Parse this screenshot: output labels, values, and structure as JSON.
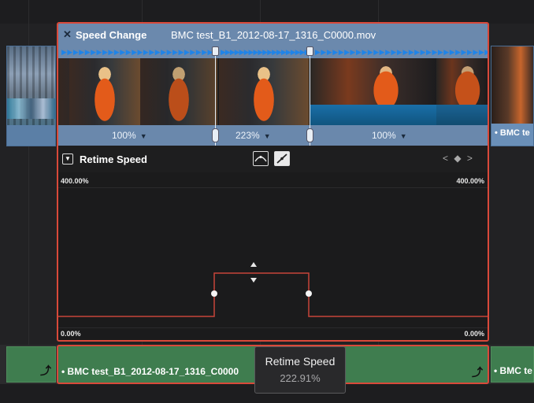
{
  "speed_change": {
    "label": "Speed Change",
    "close_icon": "close-icon",
    "clip_filename": "BMC test_B1_2012-08-17_1316_C0000.mov"
  },
  "segments": [
    {
      "speed": "100%",
      "caret": "▼"
    },
    {
      "speed": "223%",
      "caret": "▼"
    },
    {
      "speed": "100%",
      "caret": "▼"
    }
  ],
  "next_clip": {
    "label": "• BMC te"
  },
  "retime": {
    "title": "Retime Speed",
    "dropdown_glyph": "▼",
    "nav_glyph": "< ◆ >",
    "y_max_label": "400.00%",
    "y_min_label": "0.00%"
  },
  "audio": {
    "main_label": "• BMC test_B1_2012-08-17_1316_C0000",
    "next_label": "• BMC te"
  },
  "tooltip": {
    "title": "Retime Speed",
    "value": "222.91%"
  },
  "colors": {
    "selection_border": "#d9493a",
    "video_clip": "#6b89ad",
    "audio_clip": "#3f7d4f",
    "arrow_blue": "#1f84e8"
  }
}
